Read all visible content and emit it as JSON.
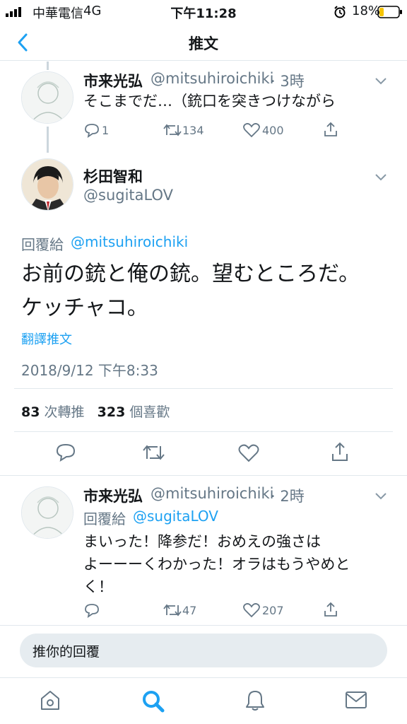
{
  "status_bar": {
    "carrier": "中華電信",
    "network": "4G",
    "time": "下午11:28",
    "battery": "18%"
  },
  "header": {
    "title": "推文"
  },
  "tweets": [
    {
      "name": "市来光弘",
      "handle": "@mitsuhiroichiki",
      "time": "· 3時",
      "text": "そこまでだ…（銃口を突きつけながら",
      "replies": "1",
      "retweets": "134",
      "likes": "400"
    }
  ],
  "main_tweet": {
    "name": "杉田智和",
    "handle": "@sugitaLOV",
    "reply_label": "回覆給",
    "reply_to": "@mitsuhiroichiki",
    "text_line1": "お前の銃と俺の銃。望むところだ。",
    "text_line2": "ケッチャコ。",
    "translate": "翻譯推文",
    "timestamp": "2018/9/12 下午8:33",
    "retweet_count": "83",
    "retweet_label": "次轉推",
    "like_count": "323",
    "like_label": "個喜歡"
  },
  "reply_tweet": {
    "name": "市来光弘",
    "handle": "@mitsuhiroichiki",
    "time": "· 2時",
    "reply_label": "回覆給",
    "reply_to": "@sugitaLOV",
    "line1": "まいった！降参だ！おめえの強さは",
    "line2": "よーーーくわかった！オラはもうやめと",
    "line3": "く！",
    "replies": "",
    "retweets": "47",
    "likes": "207"
  },
  "reply_bar": {
    "placeholder": "推你的回覆"
  },
  "colors": {
    "accent": "#1da1f2",
    "secondary_text": "#657786",
    "divider": "#e1e8ed"
  }
}
